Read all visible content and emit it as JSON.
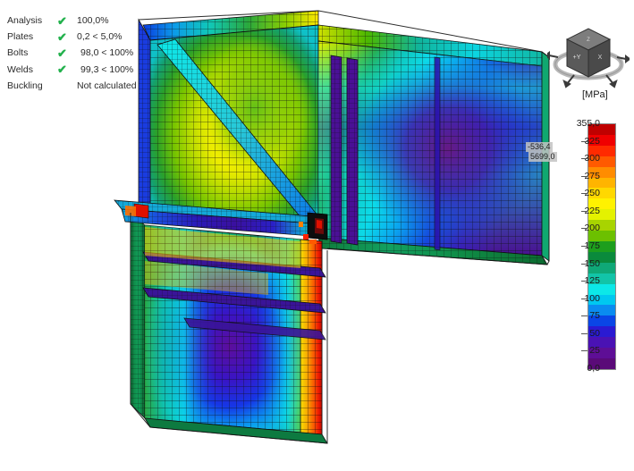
{
  "status_panel": {
    "rows": [
      {
        "label": "Analysis",
        "check": "✔",
        "value": "100,0%",
        "ok": true
      },
      {
        "label": "Plates",
        "check": "✔",
        "value": "0,2 < 5,0%",
        "ok": true
      },
      {
        "label": "Bolts",
        "check": "✔",
        "value": "98,0 < 100%",
        "ok": true
      },
      {
        "label": "Welds",
        "check": "✔",
        "value": "99,3 < 100%",
        "ok": true
      },
      {
        "label": "Buckling",
        "check": "",
        "value": "Not calculated",
        "ok": false
      }
    ],
    "check_color": "#22b14c"
  },
  "orientation_cube": {
    "face_front_label": "+Y",
    "face_right_label": "X",
    "face_top_label": "Z"
  },
  "legend": {
    "unit": "[MPa]",
    "max_label": "355,0",
    "min_label": "0,0",
    "ticks": [
      "355,0",
      "325",
      "300",
      "275",
      "250",
      "225",
      "200",
      "175",
      "150",
      "125",
      "100",
      "75",
      "50",
      "25",
      "0,0"
    ],
    "bands": [
      "#c00000",
      "#f00000",
      "#ff2a00",
      "#ff5a00",
      "#ff8c00",
      "#ffb400",
      "#ffd800",
      "#fff200",
      "#e4f200",
      "#a8d400",
      "#6cc000",
      "#1d9e1d",
      "#0a8a3c",
      "#0fa877",
      "#12c4a8",
      "#0ce8e8",
      "#00c8f0",
      "#0a8cf0",
      "#0a46e6",
      "#2a1ad2",
      "#4a12b4",
      "#5e0e96",
      "#5a0a78"
    ]
  },
  "callouts": [
    {
      "name": "deformation-value-a",
      "text": "-536,4"
    },
    {
      "name": "deformation-value-b",
      "text": "5699,0"
    }
  ],
  "model": {
    "title": "FEA stress plot of a steel beam-to-column connection",
    "background": "#ffffff"
  },
  "chart_data": {
    "type": "heatmap",
    "title": "Equivalent stress contour plot of steel connection (FEA)",
    "unit": "MPa",
    "colorbar_min": 0.0,
    "colorbar_max": 355.0,
    "colorbar_ticks": [
      0,
      25,
      50,
      75,
      100,
      125,
      150,
      175,
      200,
      225,
      250,
      275,
      300,
      325,
      355
    ],
    "annotations": [
      "-536,4",
      "5699,0"
    ],
    "checks": {
      "analysis_pct": 100.0,
      "plates_pct": 0.2,
      "plates_limit_pct": 5.0,
      "bolts_pct": 98.0,
      "bolts_limit_pct": 100.0,
      "welds_pct": 99.3,
      "welds_limit_pct": 100.0,
      "buckling": "Not calculated"
    }
  }
}
